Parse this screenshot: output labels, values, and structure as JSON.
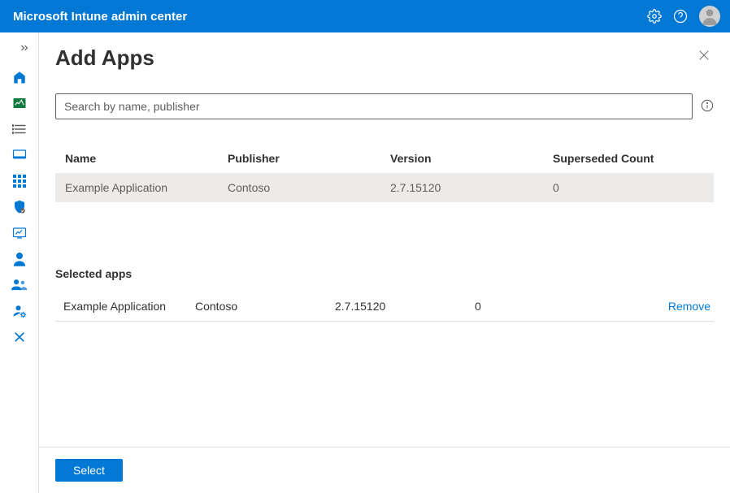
{
  "topbar": {
    "title": "Microsoft Intune admin center"
  },
  "page": {
    "title": "Add Apps"
  },
  "search": {
    "placeholder": "Search by name, publisher"
  },
  "table": {
    "headers": {
      "name": "Name",
      "publisher": "Publisher",
      "version": "Version",
      "superseded": "Superseded Count"
    },
    "rows": [
      {
        "name": "Example Application",
        "publisher": "Contoso",
        "version": "2.7.15120",
        "superseded": "0"
      }
    ]
  },
  "selected": {
    "title": "Selected apps",
    "rows": [
      {
        "name": "Example Application",
        "publisher": "Contoso",
        "version": "2.7.15120",
        "superseded": "0",
        "action": "Remove"
      }
    ]
  },
  "footer": {
    "select": "Select"
  }
}
